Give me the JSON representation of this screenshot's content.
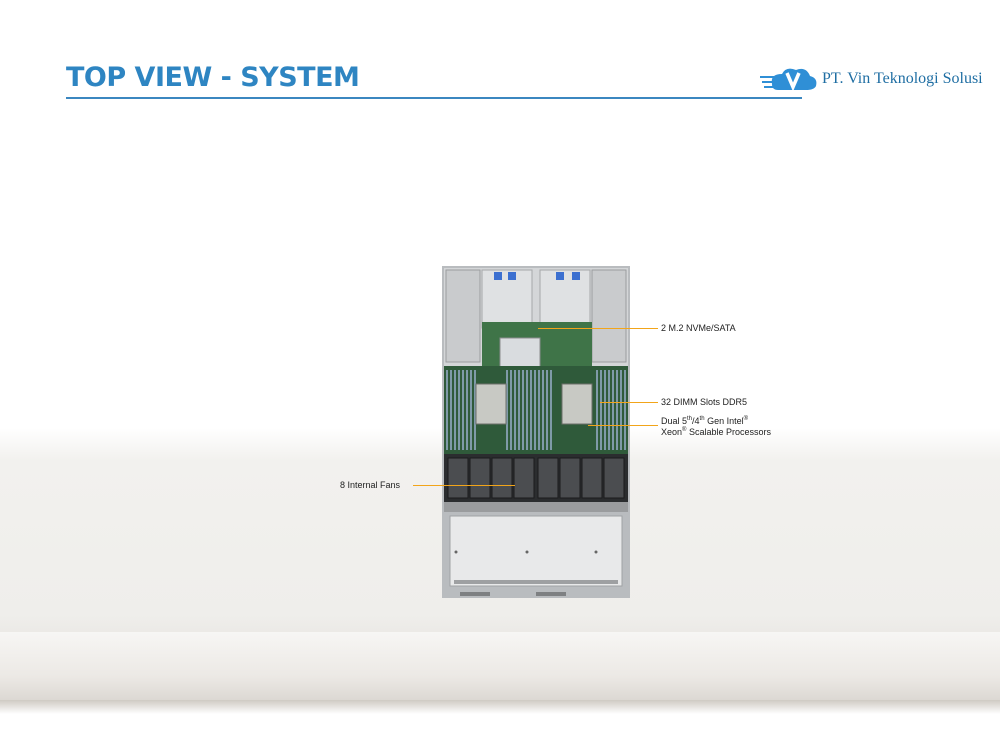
{
  "header": {
    "title": "TOP VIEW - SYSTEM",
    "company_name": "PT. Vin Teknologi Solusi"
  },
  "callouts": {
    "m2": "2 M.2 NVMe/SATA",
    "dimm": "32 DIMM Slots DDR5",
    "cpu_line1_a": "Dual 5",
    "cpu_line1_sup1": "th",
    "cpu_line1_b": "/4",
    "cpu_line1_sup2": "th",
    "cpu_line1_c": " Gen Intel",
    "cpu_line1_sup3": "®",
    "cpu_line2_a": "Xeon",
    "cpu_line2_sup": "®",
    "cpu_line2_b": " Scalable Processors",
    "fans": "8 Internal  Fans"
  },
  "colors": {
    "title": "#2e85c2",
    "rule": "#3b87c0",
    "leader": "#f2a51a"
  }
}
